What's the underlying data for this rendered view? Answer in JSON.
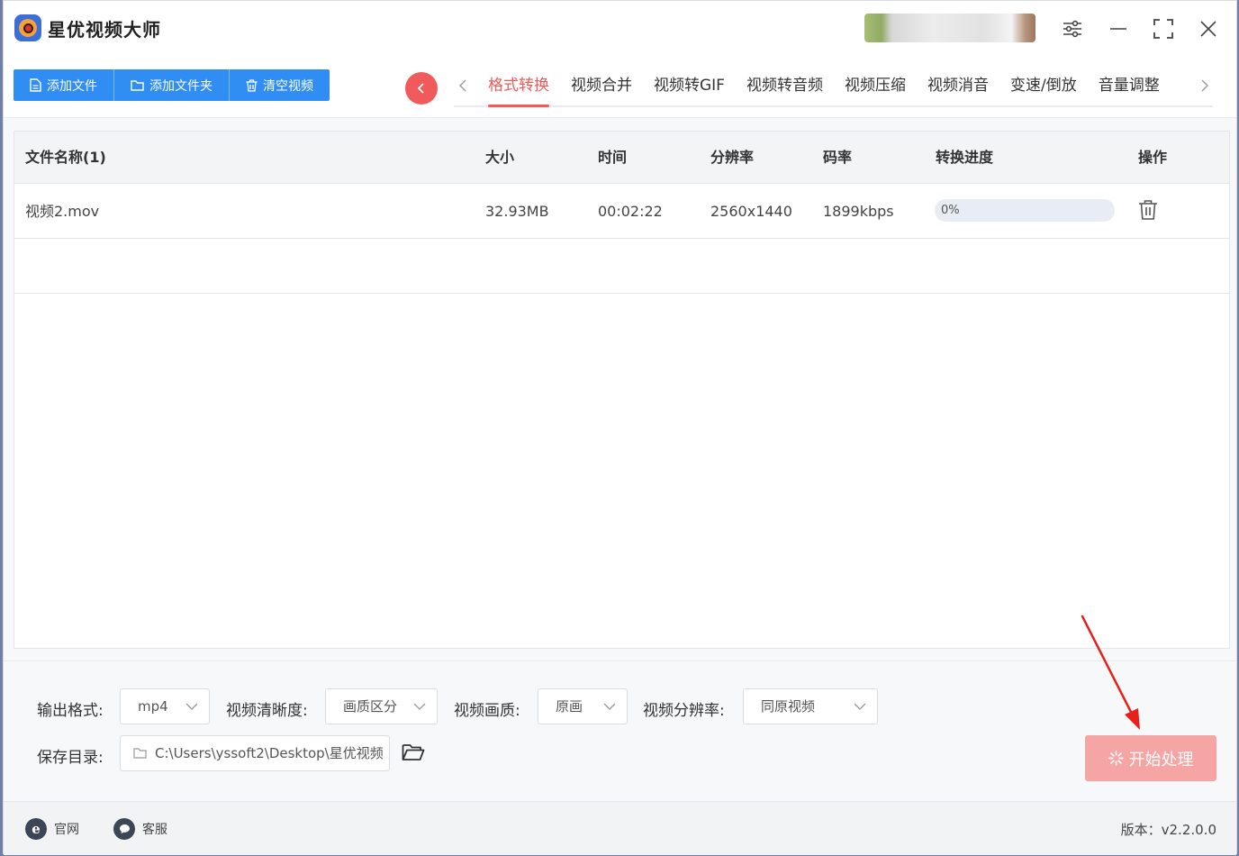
{
  "app": {
    "title": "星优视频大师"
  },
  "titlebar": {
    "icons": [
      "settings-sliders-icon",
      "minimize-icon",
      "maximize-icon",
      "close-icon"
    ]
  },
  "toolbar": {
    "add_file": "添加文件",
    "add_folder": "添加文件夹",
    "clear_videos": "清空视频",
    "accent": "#2f8df3"
  },
  "tabs": [
    {
      "label": "格式转换",
      "active": true
    },
    {
      "label": "视频合并"
    },
    {
      "label": "视频转GIF"
    },
    {
      "label": "视频转音频"
    },
    {
      "label": "视频压缩"
    },
    {
      "label": "视频消音"
    },
    {
      "label": "变速/倒放"
    },
    {
      "label": "音量调整"
    }
  ],
  "table": {
    "headers": {
      "name": "文件名称(1)",
      "size": "大小",
      "time": "时间",
      "resolution": "分辨率",
      "bitrate": "码率",
      "progress": "转换进度",
      "action": "操作"
    },
    "rows": [
      {
        "name": "视频2.mov",
        "size": "32.93MB",
        "time": "00:02:22",
        "resolution": "2560x1440",
        "bitrate": "1899kbps",
        "progress_text": "0%",
        "progress_value": 0
      }
    ]
  },
  "settings": {
    "output_format_label": "输出格式:",
    "output_format_value": "mp4",
    "clarity_label": "视频清晰度:",
    "clarity_value": "画质区分",
    "quality_label": "视频画质:",
    "quality_value": "原画",
    "resolution_label": "视频分辨率:",
    "resolution_value": "同原视频",
    "save_dir_label": "保存目录:",
    "save_dir_value": "C:\\Users\\yssoft2\\Desktop\\星优视频"
  },
  "start_button": {
    "label": "开始处理",
    "color": "#f6a5a5"
  },
  "footer": {
    "website": "官网",
    "support": "客服",
    "version": "版本：v2.2.0.0"
  },
  "colors": {
    "active_tab": "#f05a5a",
    "annotation_arrow": "#e8201a"
  }
}
